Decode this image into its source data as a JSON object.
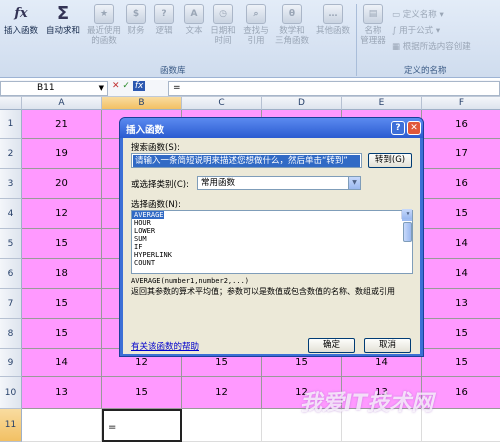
{
  "ribbon": {
    "insert_function": "插入函数",
    "autosum": "自动求和",
    "recent": [
      "最近使用",
      "的函数"
    ],
    "finance": "财务",
    "logic": "逻辑",
    "text": "文本",
    "datetime": [
      "日期和",
      "时间"
    ],
    "lookup": [
      "查找与",
      "引用"
    ],
    "math": [
      "数学和",
      "三角函数"
    ],
    "other": "其他函数",
    "library_label": "函数库",
    "name_manager": [
      "名称",
      "管理器"
    ],
    "define_name": "定义名称",
    "use_in_formula": "用于公式",
    "create_from_selection": "根据所选内容创建",
    "defined_names_label": "定义的名称"
  },
  "formula_bar": {
    "name_box": "B11",
    "fx": "fx",
    "value": "="
  },
  "columns": [
    "A",
    "B",
    "C",
    "D",
    "E",
    "F"
  ],
  "rows": [
    {
      "num": "1",
      "cells": [
        "21",
        "",
        "",
        "",
        "",
        "16"
      ]
    },
    {
      "num": "2",
      "cells": [
        "19",
        "",
        "",
        "",
        "",
        "17"
      ]
    },
    {
      "num": "3",
      "cells": [
        "20",
        "",
        "",
        "",
        "",
        "16"
      ]
    },
    {
      "num": "4",
      "cells": [
        "12",
        "",
        "",
        "",
        "",
        "15"
      ]
    },
    {
      "num": "5",
      "cells": [
        "15",
        "",
        "",
        "",
        "",
        "14"
      ]
    },
    {
      "num": "6",
      "cells": [
        "18",
        "",
        "",
        "",
        "",
        "14"
      ]
    },
    {
      "num": "7",
      "cells": [
        "15",
        "",
        "",
        "",
        "",
        "13"
      ]
    },
    {
      "num": "8",
      "cells": [
        "15",
        "",
        "",
        "",
        "",
        "15"
      ]
    },
    {
      "num": "9",
      "cells": [
        "14",
        "12",
        "15",
        "15",
        "14",
        "15"
      ]
    },
    {
      "num": "10",
      "cells": [
        "13",
        "15",
        "12",
        "12",
        "13",
        "16"
      ]
    },
    {
      "num": "11",
      "cells": [
        "",
        "=",
        "",
        "",
        "",
        ""
      ]
    }
  ],
  "dialog": {
    "title": "插入函数",
    "search_label": "搜索函数(S):",
    "search_value": "请输入一条简短说明来描述您想做什么，然后单击“转到”",
    "go_button": "转到(G)",
    "category_label": "或选择类别(C):",
    "category_value": "常用函数",
    "select_label": "选择函数(N):",
    "functions": [
      "AVERAGE",
      "HOUR",
      "LOWER",
      "SUM",
      "IF",
      "HYPERLINK",
      "COUNT"
    ],
    "signature": "AVERAGE(number1,number2,...)",
    "description": "返回其参数的算术平均值；参数可以是数值或包含数值的名称、数组或引用",
    "help_link": "有关该函数的帮助",
    "ok": "确定",
    "cancel": "取消",
    "help_icon": "?",
    "close_icon": "✕"
  },
  "watermark": "我爱IT技术网"
}
